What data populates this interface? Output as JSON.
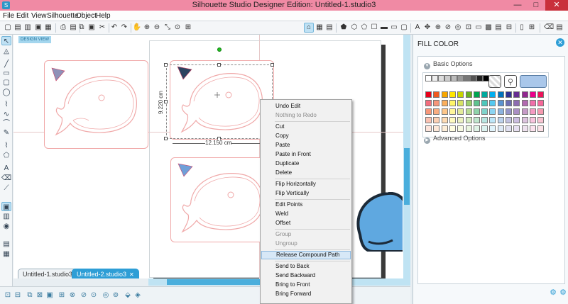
{
  "window": {
    "title": "Silhouette Studio Designer Edition: Untitled-1.studio3",
    "minimize": "—",
    "maximize": "□",
    "close": "✕"
  },
  "menubar": [
    "File",
    "Edit",
    "View",
    "Silhouette",
    "Object",
    "Help"
  ],
  "workspace": {
    "view_label": "DESIGN VIEW",
    "height_label": "9.220 cm",
    "width_label": "12.150 cm"
  },
  "tabs": [
    {
      "label": "Untitled-1.studio3",
      "active": false
    },
    {
      "label": "Untitled-2.studio3",
      "active": true
    }
  ],
  "panel": {
    "title": "FILL COLOR",
    "basic_options": "Basic Options",
    "advanced_options": "Advanced Options",
    "selected_color": "#a9c7ea"
  },
  "context_menu": [
    {
      "label": "Undo Edit",
      "enabled": true
    },
    {
      "label": "Nothing to Redo",
      "enabled": false
    },
    {
      "sep": true
    },
    {
      "label": "Cut",
      "enabled": true
    },
    {
      "label": "Copy",
      "enabled": true
    },
    {
      "label": "Paste",
      "enabled": true
    },
    {
      "label": "Paste in Front",
      "enabled": true
    },
    {
      "label": "Duplicate",
      "enabled": true
    },
    {
      "label": "Delete",
      "enabled": true
    },
    {
      "sep": true
    },
    {
      "label": "Flip Horizontally",
      "enabled": true
    },
    {
      "label": "Flip Vertically",
      "enabled": true
    },
    {
      "sep": true
    },
    {
      "label": "Edit Points",
      "enabled": true
    },
    {
      "label": "Weld",
      "enabled": true
    },
    {
      "label": "Offset",
      "enabled": true
    },
    {
      "sep": true
    },
    {
      "label": "Group",
      "enabled": false
    },
    {
      "label": "Ungroup",
      "enabled": false
    },
    {
      "sep": true
    },
    {
      "label": "Release Compound Path",
      "enabled": true,
      "highlighted": true
    },
    {
      "sep": true
    },
    {
      "label": "Send to Back",
      "enabled": true
    },
    {
      "label": "Send Backward",
      "enabled": true
    },
    {
      "label": "Bring to Front",
      "enabled": true
    },
    {
      "label": "Bring Forward",
      "enabled": true
    }
  ],
  "colors": {
    "accent": "#2e9ed6",
    "titlebar": "#f08aa4",
    "cut_line": "#f0a8a8",
    "triangle_blue": "#6f9fd8",
    "whale_blue": "#5fa8e0"
  }
}
